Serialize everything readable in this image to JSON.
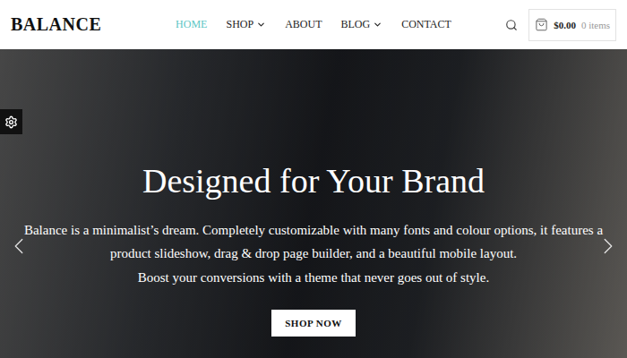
{
  "logo": "BALANCE",
  "nav": [
    {
      "label": "HOME",
      "selected": true,
      "dropdown": false
    },
    {
      "label": "SHOP",
      "selected": false,
      "dropdown": true
    },
    {
      "label": "ABOUT",
      "selected": false,
      "dropdown": false
    },
    {
      "label": "BLOG",
      "selected": false,
      "dropdown": true
    },
    {
      "label": "CONTACT",
      "selected": false,
      "dropdown": false
    }
  ],
  "cart": {
    "total": "$0.00",
    "count": "0 items"
  },
  "hero": {
    "title": "Designed for Your Brand",
    "lines": [
      "Balance is a minimalist’s dream. Completely customizable with many fonts and colour options, it features a",
      "product slideshow, drag & drop page builder, and a beautiful mobile layout.",
      "Boost your conversions with a theme that never goes out of style."
    ],
    "button": "SHOP NOW"
  }
}
